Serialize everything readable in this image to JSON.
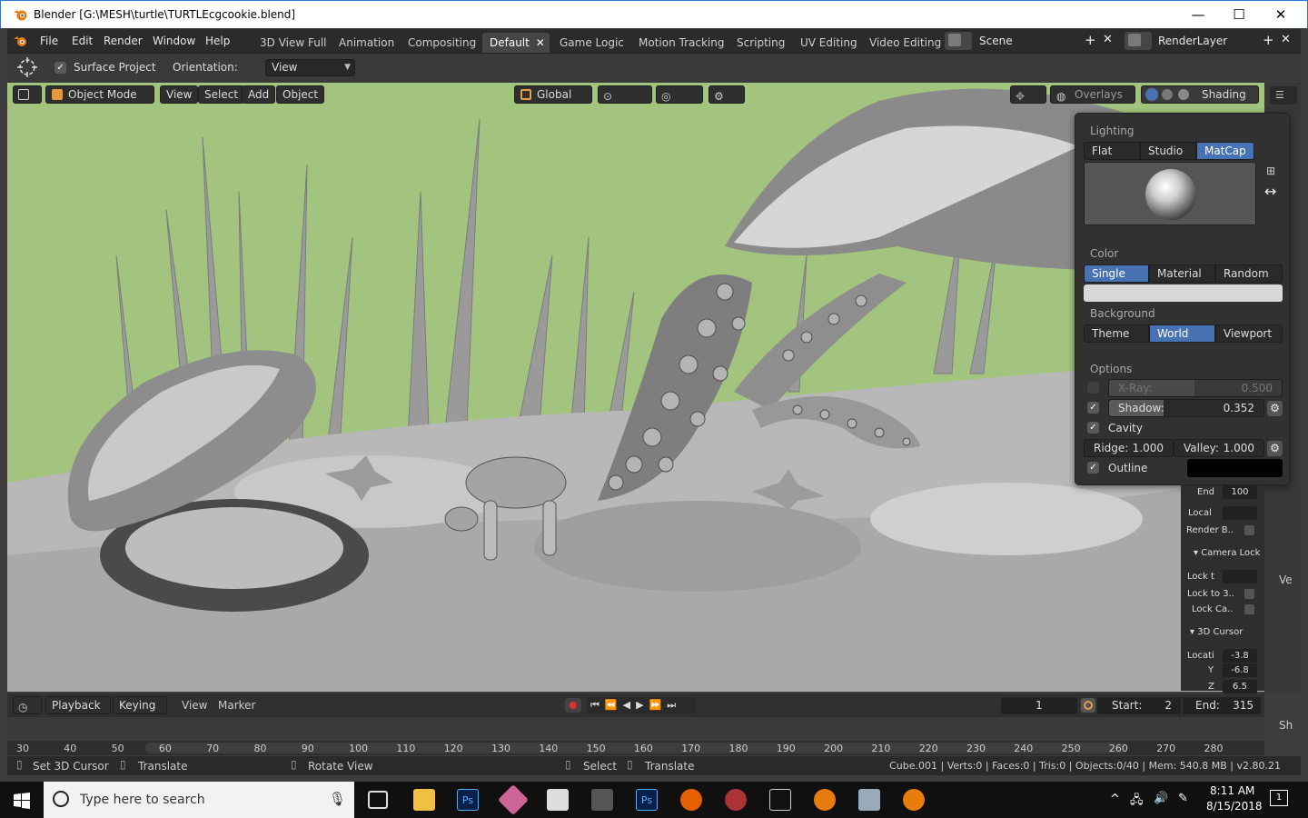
{
  "window": {
    "title": "Blender [G:\\MESH\\turtle\\TURTLEcgcookie.blend]",
    "minimize": "—",
    "maximize": "☐",
    "close": "✕"
  },
  "menus": [
    "File",
    "Edit",
    "Render",
    "Window",
    "Help"
  ],
  "workspaces": [
    "3D View Full",
    "Animation",
    "Compositing",
    "Default",
    "Game Logic",
    "Motion Tracking",
    "Scripting",
    "UV Editing",
    "Video Editing"
  ],
  "active_workspace": "Default",
  "scene": {
    "name": "Scene",
    "render_layer": "RenderLayer"
  },
  "toolsettings": {
    "surface_project_label": "Surface Project",
    "orientation_label": "Orientation:",
    "orientation_value": "View"
  },
  "viewport_header": {
    "mode": "Object Mode",
    "menus": [
      "View",
      "Select",
      "Add",
      "Object"
    ],
    "transform_orientation": "Global",
    "overlays": "Overlays",
    "shading": "Shading"
  },
  "shading_popover": {
    "lighting_label": "Lighting",
    "lighting": [
      "Flat",
      "Studio",
      "MatCap"
    ],
    "lighting_active": "MatCap",
    "color_label": "Color",
    "color": [
      "Single",
      "Material",
      "Random"
    ],
    "color_active": "Single",
    "background_label": "Background",
    "background": [
      "Theme",
      "World",
      "Viewport"
    ],
    "background_active": "World",
    "options_label": "Options",
    "xray_label": "X-Ray:",
    "xray_value": "0.500",
    "xray_enabled": false,
    "shadow_label": "Shadow:",
    "shadow_value": "0.352",
    "shadow_enabled": true,
    "cavity_label": "Cavity",
    "cavity_enabled": true,
    "ridge_label": "Ridge:",
    "ridge_value": "1.000",
    "valley_label": "Valley:",
    "valley_value": "1.000",
    "outline_label": "Outline",
    "outline_enabled": true,
    "outline_color": "#000000"
  },
  "sidebar": {
    "end_label": "End",
    "end_value": "100",
    "local_label": "Local",
    "render_border_label": "Render B..",
    "camera_lock_label": "Camera Lock",
    "lock_to_object_label": "Lock t",
    "lock_to_3d_label": "Lock to 3..",
    "lock_camera_label": "Lock Ca..",
    "cursor_label": "3D Cursor",
    "location_label": "Locati",
    "cursor_x": "-3.8",
    "y_label": "Y",
    "cursor_y": "-6.8",
    "z_label": "Z",
    "cursor_z": "6.5"
  },
  "right_strip": {
    "view_label": "Ve",
    "sh_label": "Sh"
  },
  "timeline": {
    "playback": "Playback",
    "keying": "Keying",
    "view": "View",
    "marker": "Marker",
    "current_frame": "1",
    "start_label": "Start:",
    "start": "2",
    "end_label": "End:",
    "end": "315",
    "ticks": [
      "30",
      "40",
      "50",
      "60",
      "70",
      "80",
      "90",
      "100",
      "110",
      "120",
      "130",
      "140",
      "150",
      "160",
      "170",
      "180",
      "190",
      "200",
      "210",
      "220",
      "230",
      "240",
      "250",
      "260",
      "270",
      "280"
    ]
  },
  "statusbar": {
    "set_cursor": "Set 3D Cursor",
    "translate1": "Translate",
    "rotate_view": "Rotate View",
    "select": "Select",
    "translate2": "Translate",
    "stats": "Cube.001 | Verts:0 | Faces:0 | Tris:0 | Objects:0/40 | Mem: 540.8 MB | v2.80.21"
  },
  "taskbar": {
    "search_placeholder": "Type here to search",
    "time": "8:11 AM",
    "date": "8/15/2018",
    "notifications": "1"
  }
}
